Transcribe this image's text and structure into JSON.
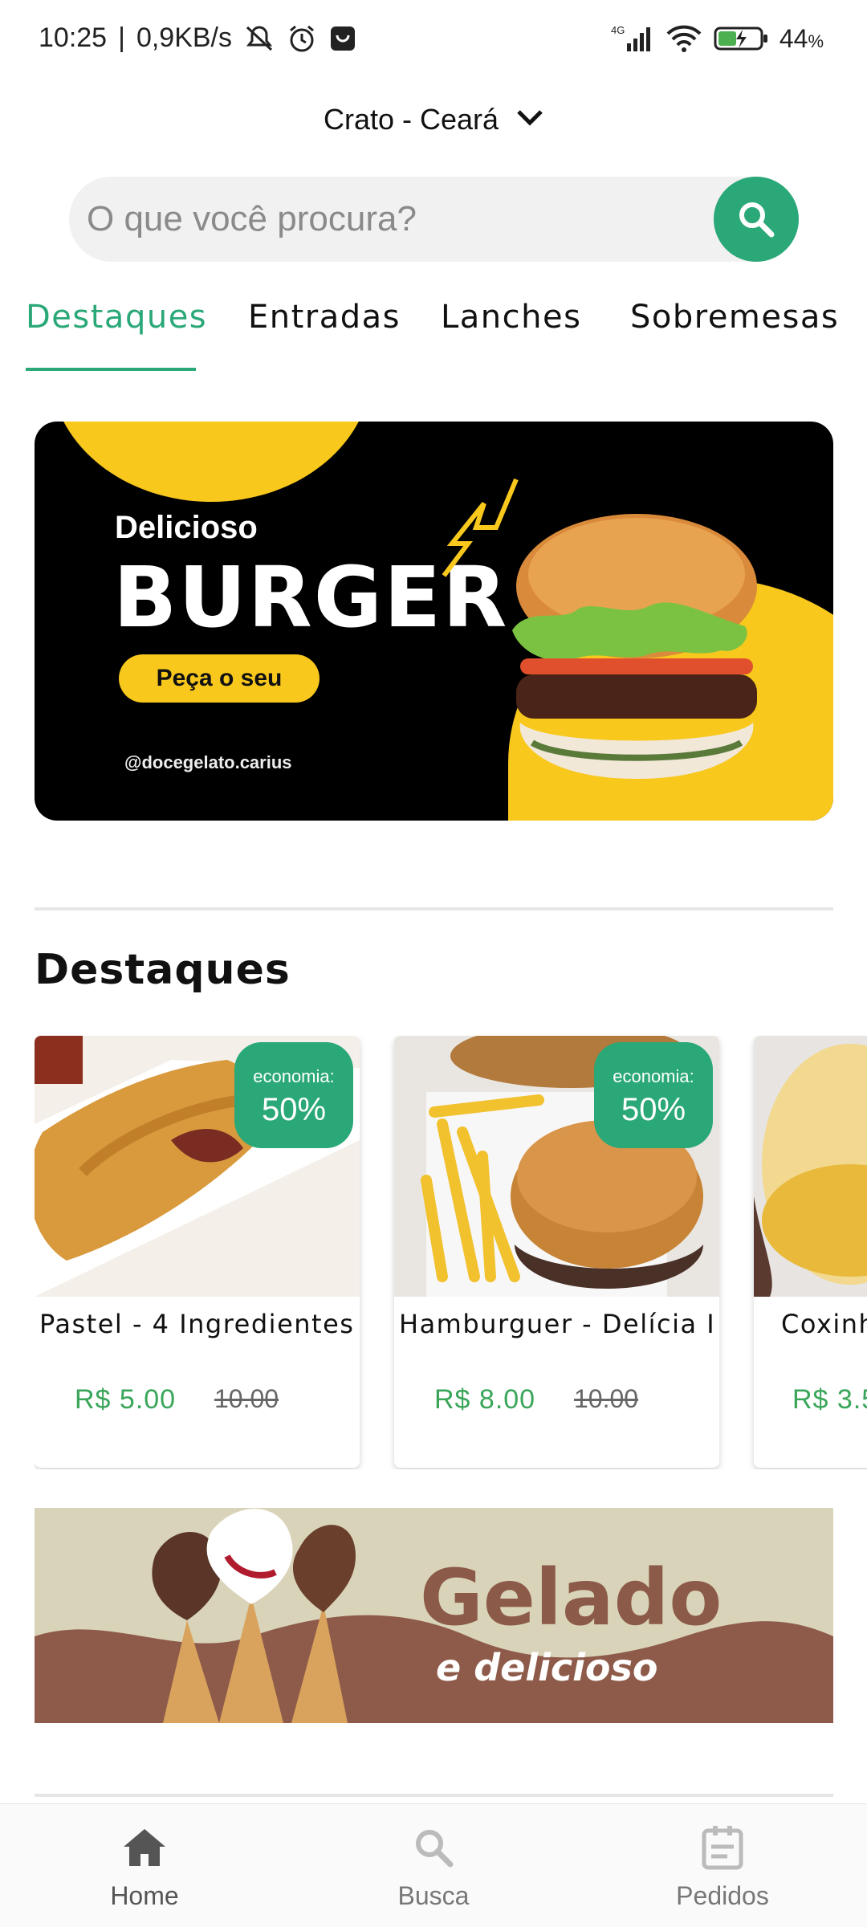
{
  "status_bar": {
    "time": "10:25",
    "network_speed": "0,9KB/s",
    "network_type": "4G",
    "battery": "44",
    "battery_unit": "%"
  },
  "location": {
    "label": "Crato - Ceará",
    "icon": "chevron-down-icon"
  },
  "search": {
    "placeholder": "O que você procura?",
    "icon": "search-icon"
  },
  "tabs": [
    {
      "label": "Destaques",
      "active": true
    },
    {
      "label": "Entradas",
      "active": false
    },
    {
      "label": "Lanches",
      "active": false
    },
    {
      "label": "Sobremesas",
      "active": false
    }
  ],
  "banner": {
    "kicker": "Delicioso",
    "title": "BURGER",
    "cta": "Peça o seu",
    "handle": "@docegelato.carius",
    "slides": 3,
    "active_slide": 1
  },
  "section": {
    "title": "Destaques"
  },
  "products": [
    {
      "name": "Pastel - 4 Ingredientes",
      "price": "R$ 5.00",
      "old_price": "10.00",
      "badge_label": "economia:",
      "badge_value": "50%"
    },
    {
      "name": "Hamburguer - Delícia I",
      "price": "R$ 8.00",
      "old_price": "10.00",
      "badge_label": "economia:",
      "badge_value": "50%"
    },
    {
      "name": "Coxinh",
      "price": "R$ 3.5",
      "old_price": "",
      "badge_label": "",
      "badge_value": ""
    }
  ],
  "promo_banner": {
    "title": "Gelado",
    "subtitle": "e delicioso"
  },
  "bottom_nav": [
    {
      "label": "Home",
      "icon": "home-icon",
      "active": true
    },
    {
      "label": "Busca",
      "icon": "search-icon",
      "active": false
    },
    {
      "label": "Pedidos",
      "icon": "orders-icon",
      "active": false
    }
  ],
  "colors": {
    "accent": "#2aa877",
    "price_green": "#3aa65a",
    "banner_yellow": "#f8c81d",
    "ice_brown": "#8c5a48"
  }
}
